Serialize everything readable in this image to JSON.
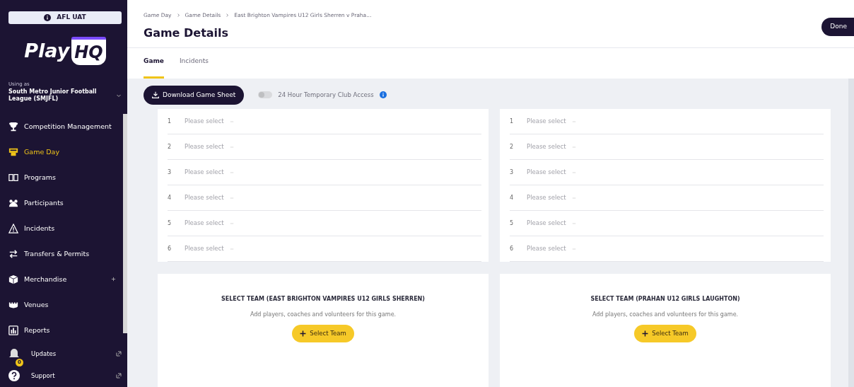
{
  "environment_badge": {
    "label": "AFL UAT"
  },
  "brand": {
    "logo_text": "Play",
    "logo_shield_text": "HQ"
  },
  "account": {
    "caption": "Using as",
    "organisation": "South Metro Junior Football League (SMJFL)"
  },
  "sidebar": {
    "items": [
      {
        "label": "Competition Management",
        "selected": false
      },
      {
        "label": "Game Day",
        "selected": true
      },
      {
        "label": "Programs",
        "selected": false
      },
      {
        "label": "Participants",
        "selected": false
      },
      {
        "label": "Incidents",
        "selected": false
      },
      {
        "label": "Transfers & Permits",
        "selected": false
      },
      {
        "label": "Merchandise",
        "selected": false,
        "expandable": true
      },
      {
        "label": "Venues",
        "selected": false
      },
      {
        "label": "Reports",
        "selected": false
      }
    ],
    "footer_items": [
      {
        "label": "Updates",
        "badge": "0"
      },
      {
        "label": "Support"
      }
    ]
  },
  "breadcrumb": [
    "Game Day",
    "Game Details",
    "East Brighton Vampires U12 Girls Sherren v Praha..."
  ],
  "page_title": "Game Details",
  "done_button": "Done",
  "tabs": [
    {
      "label": "Game",
      "selected": true
    },
    {
      "label": "Incidents",
      "selected": false
    }
  ],
  "download_button": "Download Game Sheet",
  "club_access_toggle": {
    "label": "24 Hour Temporary Club Access",
    "on": false,
    "disabled": true
  },
  "teams": [
    {
      "slots": [
        {
          "number": "1",
          "placeholder": "Please select"
        },
        {
          "number": "2",
          "placeholder": "Please select"
        },
        {
          "number": "3",
          "placeholder": "Please select"
        },
        {
          "number": "4",
          "placeholder": "Please select"
        },
        {
          "number": "5",
          "placeholder": "Please select"
        },
        {
          "number": "6",
          "placeholder": "Please select"
        }
      ],
      "select_title": "SELECT TEAM (EAST BRIGHTON VAMPIRES U12 GIRLS SHERREN)",
      "select_hint": "Add players, coaches and volunteers for this game.",
      "select_button": "Select Team"
    },
    {
      "slots": [
        {
          "number": "1",
          "placeholder": "Please select"
        },
        {
          "number": "2",
          "placeholder": "Please select"
        },
        {
          "number": "3",
          "placeholder": "Please select"
        },
        {
          "number": "4",
          "placeholder": "Please select"
        },
        {
          "number": "5",
          "placeholder": "Please select"
        },
        {
          "number": "6",
          "placeholder": "Please select"
        }
      ],
      "select_title": "SELECT TEAM (PRAHAN U12 GIRLS LAUGHTON)",
      "select_hint": "Add players, coaches and volunteers for this game.",
      "select_button": "Select Team"
    }
  ]
}
